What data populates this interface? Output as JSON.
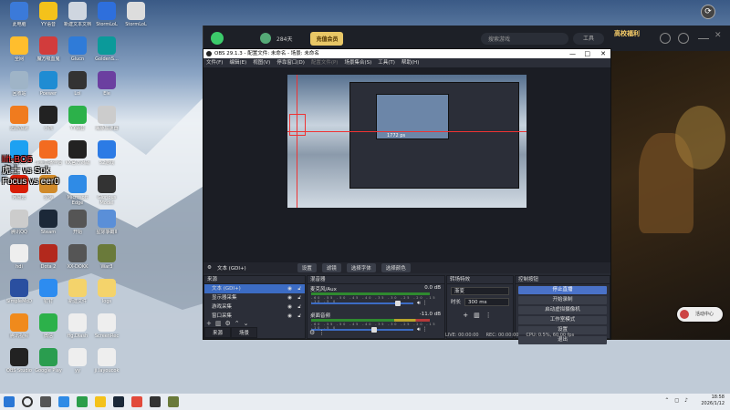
{
  "overlay_text": [
    "lift-BO5",
    "虎士 vs Sok",
    "Focus vs eer0"
  ],
  "desktop_icons": [
    {
      "label": "此电脑",
      "color": "#3b7ad9"
    },
    {
      "label": "YY语音",
      "color": "#f4c21b"
    },
    {
      "label": "新建文本文档",
      "color": "#cfd6e0"
    },
    {
      "label": "StormLoL",
      "color": "#2e6fdc"
    },
    {
      "label": "StormLoL",
      "color": "#ddd"
    },
    {
      "label": "全网",
      "color": "#ffbe2d"
    },
    {
      "label": "魔方吸血鬼",
      "color": "#d23c3c"
    },
    {
      "label": "Glucn",
      "color": "#2f7bd8"
    },
    {
      "label": "GoldenS...",
      "color": "#0b9a9a"
    },
    {
      "label": "回收站",
      "color": "#9fb4c7"
    },
    {
      "label": "Poewer",
      "color": "#1f8cd3"
    },
    {
      "label": "Lol",
      "color": "#333"
    },
    {
      "label": "Ele",
      "color": "#6b3fa0"
    },
    {
      "label": "迅游加速",
      "color": "#f07b1e"
    },
    {
      "label": "小熊",
      "color": "#222"
    },
    {
      "label": "YY语音",
      "color": "#2cb14a"
    },
    {
      "label": "海豚加速器",
      "color": "#ccc"
    },
    {
      "label": "腾讯QQ",
      "color": "#1da1f2"
    },
    {
      "label": "斗鱼直播伴侣",
      "color": "#f36b20"
    },
    {
      "label": "KK官方对战",
      "color": "#222"
    },
    {
      "label": "52游戏",
      "color": "#2c7be5"
    },
    {
      "label": "网易云",
      "color": "#d81e06"
    },
    {
      "label": "星海",
      "color": "#d08a2a"
    },
    {
      "label": "Microsoft Edge",
      "color": "#2f8be6"
    },
    {
      "label": "Glorious Model",
      "color": "#333"
    },
    {
      "label": "腾讯QQ",
      "color": "#ccc"
    },
    {
      "label": "Steam",
      "color": "#1b2838"
    },
    {
      "label": "开始",
      "color": "#555"
    },
    {
      "label": "星际争霸II",
      "color": "#5a8fd8"
    },
    {
      "label": "hdi",
      "color": "#eee"
    },
    {
      "label": "Dota 2",
      "color": "#b3291d"
    },
    {
      "label": "XX-DOKK",
      "color": "#555"
    },
    {
      "label": "War3",
      "color": "#6a7a3a"
    },
    {
      "label": "SimpleMcD",
      "color": "#2a4fa0"
    },
    {
      "label": "钉钉",
      "color": "#2d8cf0"
    },
    {
      "label": "新建文件",
      "color": "#f4d36b"
    },
    {
      "label": "logs",
      "color": "#f4d36b"
    },
    {
      "label": "腾讯视频",
      "color": "#f08a1c"
    },
    {
      "label": "微信",
      "color": "#2cb14a"
    },
    {
      "label": "ffg.Dlash",
      "color": "#eee"
    },
    {
      "label": "ScreenRec",
      "color": "#eee"
    },
    {
      "label": "OBS Studio",
      "color": "#222"
    },
    {
      "label": "Google Play",
      "color": "#2a9d4f"
    },
    {
      "label": "yy",
      "color": "#eee"
    },
    {
      "label": "ji.layoucok",
      "color": "#eee"
    }
  ],
  "launcher": {
    "days": "284天",
    "vip_button": "充值会员",
    "search_placeholder": "搜索游戏",
    "tool_label": "工具",
    "promo": "高校福利",
    "pill": "活动中心"
  },
  "obs": {
    "title": "OBS 29.1.3 - 配置文件: 未命名 - 场景: 未命名",
    "window_controls": [
      "—",
      "□",
      "✕"
    ],
    "menu": [
      "文件(F)",
      "编辑(E)",
      "视图(V)",
      "停靠窗口(D)",
      "配置文件(P)",
      "场景集合(S)",
      "工具(T)",
      "帮助(H)"
    ],
    "preview_label": "1772 ps",
    "source_bar": {
      "source_name": "文本 (GDI+)",
      "settings": "设置",
      "filters": "滤镜",
      "select_text": "选择字体",
      "select_color": "选择颜色"
    },
    "sources": {
      "header": "来源",
      "items": [
        {
          "name": "文本 (GDI+)",
          "selected": true
        },
        {
          "name": "显示器采集",
          "selected": false
        },
        {
          "name": "游戏采集",
          "selected": false
        },
        {
          "name": "窗口采集",
          "selected": false
        }
      ],
      "tabs": [
        "来源",
        "场景"
      ]
    },
    "mixer": {
      "header": "混音器",
      "channels": [
        {
          "name": "麦克风/Aux",
          "db": "0.0 dB",
          "level": 0.85
        },
        {
          "name": "桌面音频",
          "db": "-11.0 dB",
          "level": 0.62
        }
      ],
      "scale": "-60 -55 -50 -45 -40 -35 -30 -25 -20 -15 -10 -5 0"
    },
    "transitions": {
      "header": "转场特效",
      "type": "渐变",
      "duration_label": "时长",
      "duration": "300 ms"
    },
    "controls": {
      "header": "控制按钮",
      "buttons": [
        "停止直播",
        "开始录制",
        "启动虚拟摄像机",
        "工作室模式",
        "设置",
        "退出"
      ]
    },
    "status": {
      "live": "LIVE: 00:00:00",
      "rec": "REC: 00:00:00",
      "cpu": "CPU: 0.5%, 60.00 fps"
    }
  },
  "taskbar": {
    "time": "18:58",
    "date": "2026/1/12"
  }
}
